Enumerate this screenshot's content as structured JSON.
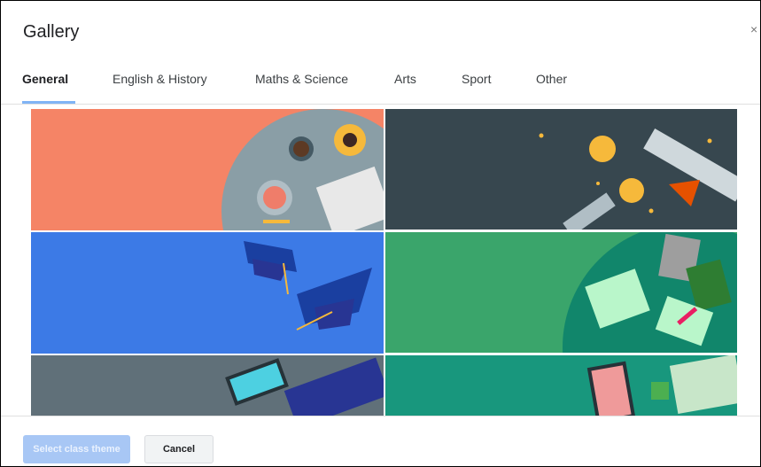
{
  "dialog": {
    "title": "Gallery"
  },
  "close_icon": "×",
  "tabs": [
    {
      "label": "General"
    },
    {
      "label": "English & History"
    },
    {
      "label": "Maths & Science"
    },
    {
      "label": "Arts"
    },
    {
      "label": "Sport"
    },
    {
      "label": "Other"
    }
  ],
  "active_tab": "General",
  "themes": [
    {
      "color": "#f58466",
      "selected": true
    },
    {
      "color": "#37474f"
    },
    {
      "color": "#3c7ae6"
    },
    {
      "color": "#3aa56b"
    },
    {
      "color": "#607079"
    },
    {
      "color": "#18977d"
    }
  ],
  "footer": {
    "primary_label": "Select class theme",
    "secondary_label": "Cancel"
  }
}
